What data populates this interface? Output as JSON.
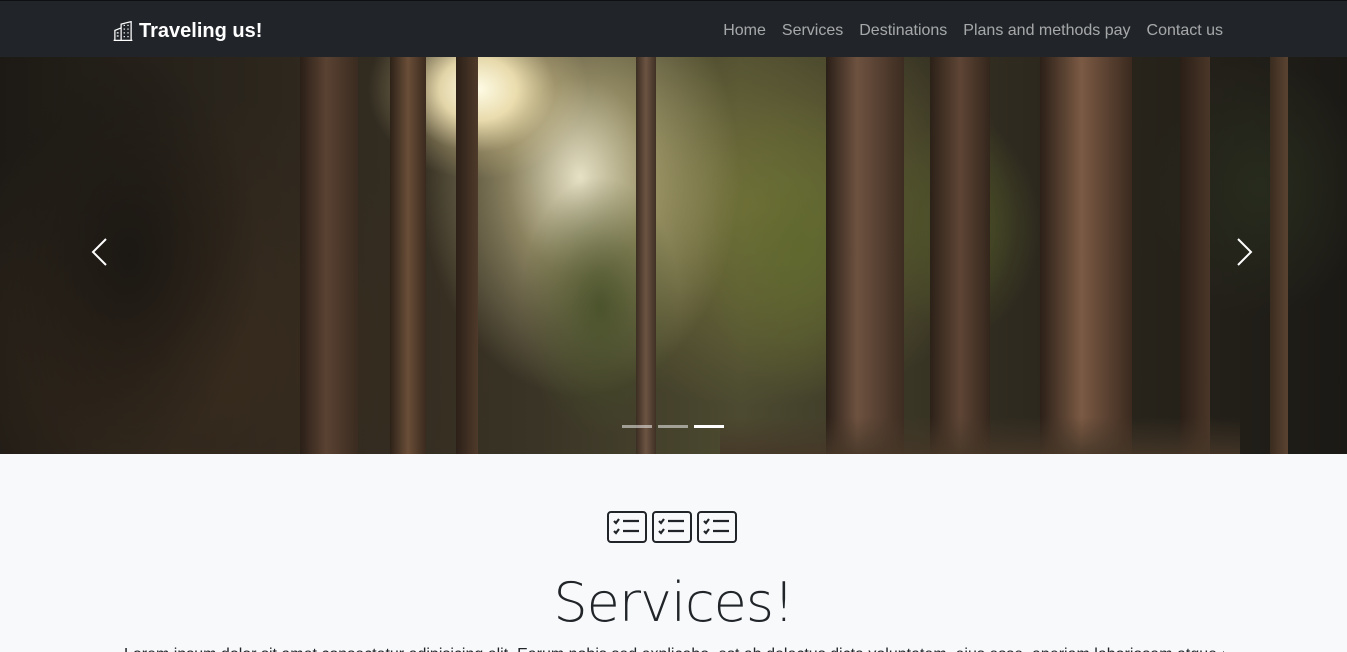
{
  "navbar": {
    "brand": "Traveling us!",
    "brand_icon": "buildings-icon",
    "links": [
      "Home",
      "Services",
      "Destinations",
      "Plans and methods pay",
      "Contact us"
    ]
  },
  "carousel": {
    "prev_icon": "chevron-left-icon",
    "next_icon": "chevron-right-icon",
    "slide_count": 3,
    "active_slide": 3
  },
  "services": {
    "icon": "card-checklist-icon",
    "title": "Services!",
    "text": "Lorem ipsum dolor sit amet consectetur adipisicing elit. Earum nobis sed explicabo, est ab delectus dicta voluptatem, eius esse, aperiam laboriosam atque et"
  },
  "colors": {
    "navbar_bg": "#212529",
    "nav_link": "rgba(255,255,255,0.6)",
    "page_bg": "#f8f9fa"
  }
}
